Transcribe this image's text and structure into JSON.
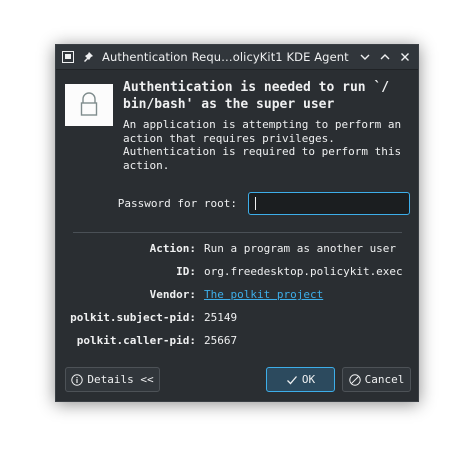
{
  "window": {
    "title": "Authentication Requ…olicyKit1 KDE Agent"
  },
  "titlebar_icons": {
    "app": "app-window-icon",
    "pin": "pin-icon",
    "minimize": "chevron-down-icon",
    "maximize": "chevron-up-icon",
    "close": "close-icon"
  },
  "heading": {
    "line1": "Authentication is needed to run `/",
    "line2": "bin/bash' as the super user"
  },
  "description": {
    "line1": "An application is attempting to perform an",
    "line2": "action that requires privileges.",
    "line3": "Authentication is required to perform this",
    "line4": "action."
  },
  "password": {
    "label": "Password for root:",
    "value": ""
  },
  "details": [
    {
      "key": "Action:",
      "value": "Run a program as another user",
      "link": false
    },
    {
      "key": "ID:",
      "value": "org.freedesktop.policykit.exec",
      "link": false
    },
    {
      "key": "Vendor:",
      "value": "The polkit project",
      "link": true
    },
    {
      "key": "polkit.subject-pid:",
      "value": "25149",
      "link": false
    },
    {
      "key": "polkit.caller-pid:",
      "value": "25667",
      "link": false
    }
  ],
  "buttons": {
    "details": "Details <<",
    "ok": "OK",
    "cancel": "Cancel"
  },
  "colors": {
    "accent": "#3daee9",
    "window_bg": "#2a2e32",
    "text": "#eff0f1"
  }
}
